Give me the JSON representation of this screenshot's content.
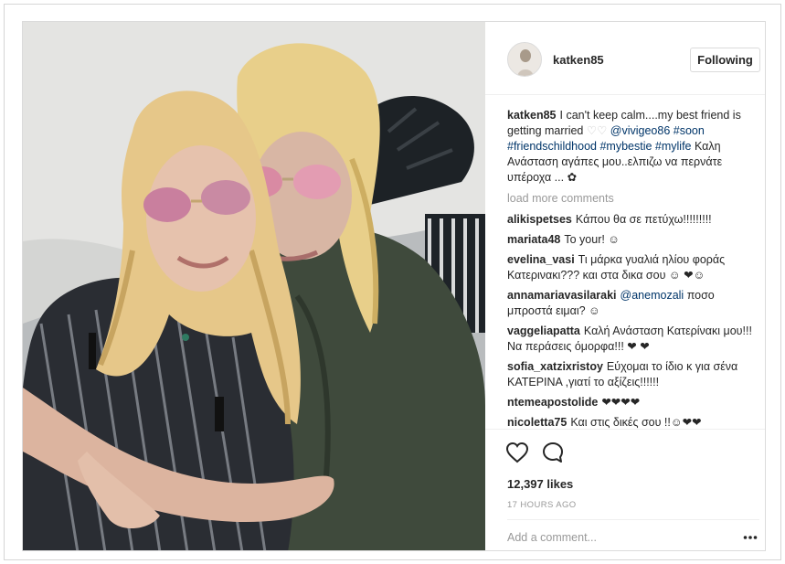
{
  "post": {
    "username": "katken85",
    "follow_label": "Following",
    "caption": {
      "username": "katken85",
      "text_1": "I can't keep calm....my best friend is getting married ",
      "hearts": "♡♡",
      "mention": "@vivigeo86",
      "tag_soon": "#soon",
      "tags_line": "#friendschildhood #mybestie #mylife",
      "text_2": "Καλη Ανάσταση αγάπες μου..ελπιζω να περνάτε υπέροχα ...",
      "emoji": "✿"
    },
    "load_more_label": "load more comments",
    "comments": [
      {
        "user": "alikispetses",
        "text": "Κάπου θα σε πετύχω!!!!!!!!!"
      },
      {
        "user": "mariata48",
        "text": "To your! ☺"
      },
      {
        "user": "evelina_vasi",
        "text": "Τι μάρκα γυαλιά ηλίου φοράς Κατερινακι??? και στα δικα σου ☺ ❤☺"
      },
      {
        "user": "annamariavasilaraki",
        "mention": "@anemozali",
        "text": "ποσο μπροστά ειμαι? ☺"
      },
      {
        "user": "vaggeliapatta",
        "text": "Καλή Ανάσταση Κατερίνακι μου!!! Να περάσεις όμορφα!!! ❤ ❤"
      },
      {
        "user": "sofia_xatzixristoy",
        "text": "Εύχομαι το ίδιο κ για σένα ΚΑΤΕΡΙΝΑ ,γιατί το αξίζεις!!!!!!"
      },
      {
        "user": "ntemeapostolide",
        "text": "❤❤❤❤"
      },
      {
        "user": "nicoletta75",
        "text": "Και στις δικές σου !!☺❤❤"
      }
    ],
    "likes": "12,397 likes",
    "timestamp": "17 HOURS AGO",
    "add_comment_placeholder": "Add a comment...",
    "more_icon": "more-icon",
    "icons": [
      "heart-icon",
      "comment-icon",
      "more-icon"
    ],
    "colors": {
      "tag": "#003569",
      "muted": "#999999",
      "border": "#dbdbdb"
    }
  }
}
